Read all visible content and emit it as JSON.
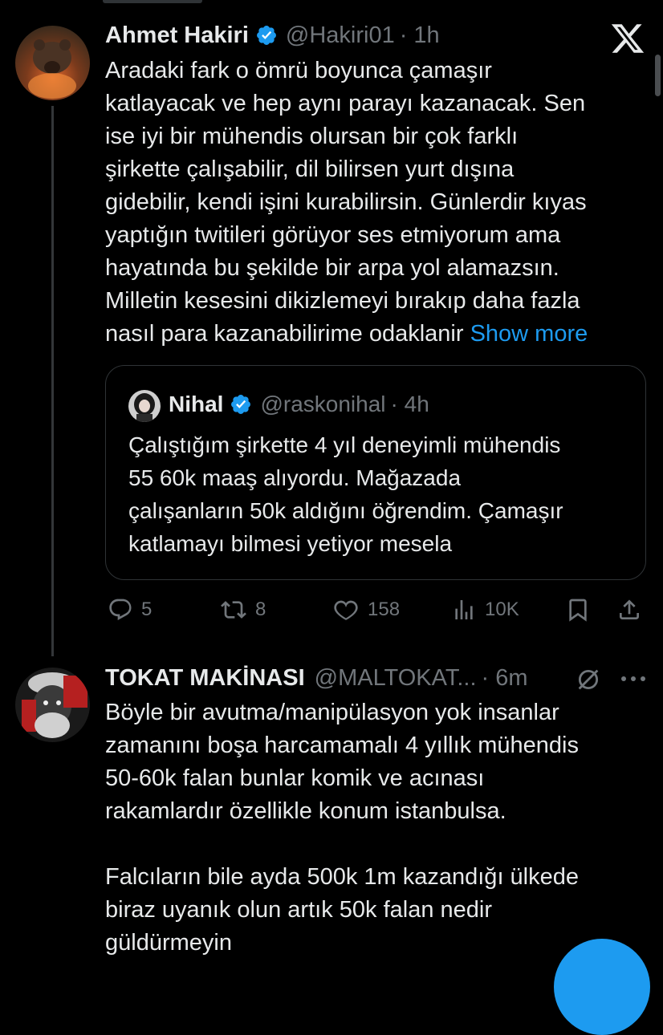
{
  "tweet": {
    "name": "Ahmet Hakiri",
    "handle": "@Hakiri01",
    "time": "· 1h",
    "lines": [
      "Aradaki fark o ömrü boyunca çamaşır",
      "katlayacak ve hep aynı parayı kazanacak. Sen",
      "ise iyi bir mühendis olursan bir çok farklı",
      "şirkette çalışabilir, dil bilirsen yurt dışına",
      "gidebilir, kendi işini kurabilirsin. Günlerdir kıyas",
      "yaptığın twitileri görüyor ses etmiyorum ama",
      "hayatında bu şekilde bir arpa yol alamazsın.",
      "Milletin kesesini dikizlemeyi bırakıp daha fazla",
      "nasıl para kazanabilirime odaklanir"
    ],
    "show_more": "Show more",
    "actions": {
      "replies": "5",
      "retweets": "8",
      "likes": "158",
      "views": "10K"
    }
  },
  "quote": {
    "name": "Nihal",
    "handle": "@raskonihal",
    "time": "· 4h",
    "lines": [
      "Çalıştığım şirkette 4 yıl deneyimli mühendis",
      "55 60k maaş alıyordu. Mağazada",
      "çalışanların 50k aldığını öğrendim. Çamaşır",
      "katlamayı bilmesi yetiyor mesela"
    ]
  },
  "reply": {
    "name": "TOKAT MAKİNASI",
    "handle": "@MALTOKAT...",
    "time": "· 6m",
    "lines": [
      "Böyle bir avutma/manipülasyon yok insanlar",
      "zamanını boşa harcamamalı 4 yıllık mühendis",
      "50-60k falan bunlar komik ve acınası",
      "rakamlardır özellikle konum istanbulsa.",
      "",
      "Falcıların bile ayda 500k 1m kazandığı ülkede",
      "biraz uyanık olun artık 50k falan nedir",
      "güldürmeyin"
    ]
  },
  "colors": {
    "background": "#000000",
    "text": "#e7e9ea",
    "secondary": "#71767b",
    "accent": "#1d9bf0",
    "border": "#2f3336"
  },
  "icons": [
    "x-logo-icon",
    "verified-badge-icon",
    "reply-icon",
    "retweet-icon",
    "like-icon",
    "views-icon",
    "bookmark-icon",
    "share-icon",
    "mute-icon",
    "more-icon"
  ]
}
